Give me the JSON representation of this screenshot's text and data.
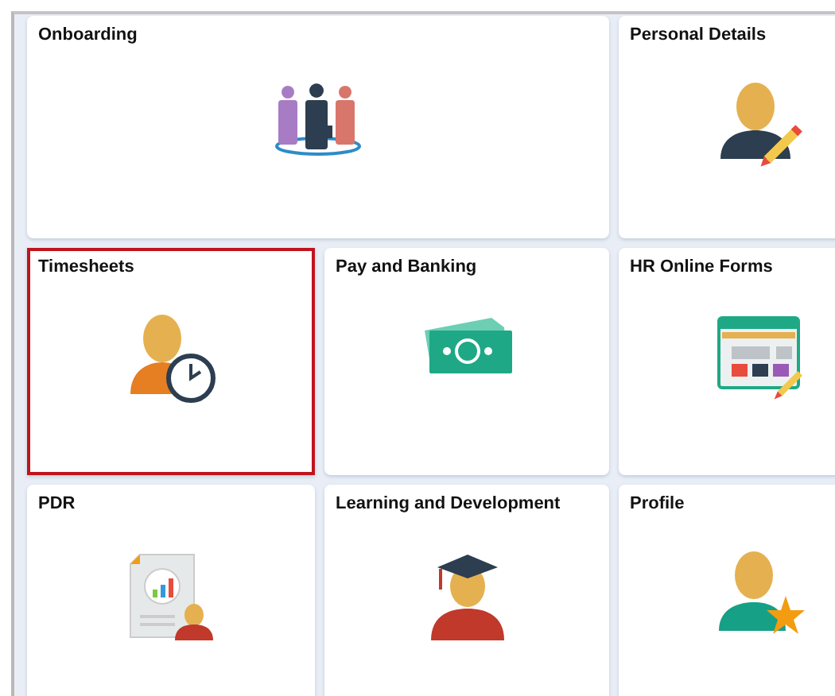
{
  "tiles": [
    {
      "title": "Onboarding",
      "kind": "people",
      "wide": true,
      "selected": false
    },
    {
      "title": "Personal Details",
      "kind": "person-pencil",
      "wide": false,
      "selected": false
    },
    {
      "title": "Timesheets",
      "kind": "person-clock",
      "wide": false,
      "selected": true
    },
    {
      "title": "Pay and Banking",
      "kind": "money",
      "wide": false,
      "selected": false
    },
    {
      "title": "HR Online Forms",
      "kind": "form",
      "wide": false,
      "selected": false
    },
    {
      "title": "PDR",
      "kind": "report",
      "wide": false,
      "selected": false
    },
    {
      "title": "Learning and Development",
      "kind": "graduate",
      "wide": false,
      "selected": false
    },
    {
      "title": "Profile",
      "kind": "person-star",
      "wide": false,
      "selected": false
    }
  ]
}
